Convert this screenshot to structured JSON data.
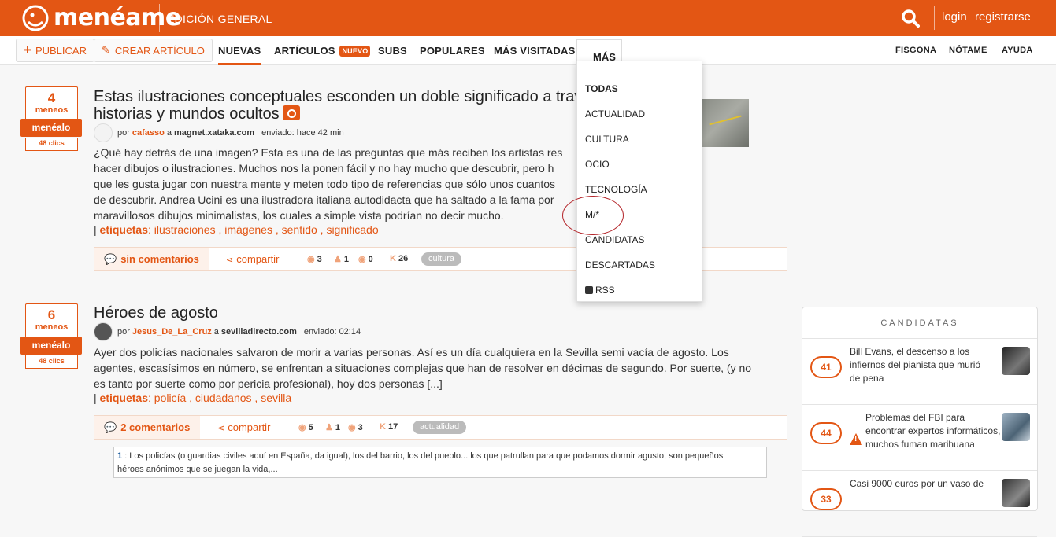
{
  "header": {
    "logo_text": "menéame",
    "edition": "EDICIÓN GENERAL",
    "login": "login",
    "register": "registrarse",
    "accent": "#e35614"
  },
  "nav": {
    "publish": "PUBLICAR",
    "create_article": "CREAR ARTÍCULO",
    "links": [
      "NUEVAS",
      "ARTÍCULOS",
      "SUBS",
      "POPULARES",
      "MÁS VISITADAS",
      "MÁS"
    ],
    "new_badge": "NUEVO",
    "right_links": [
      "FISGONA",
      "NÓTAME",
      "AYUDA"
    ]
  },
  "dropdown": {
    "items": [
      "TODAS",
      "ACTUALIDAD",
      "CULTURA",
      "OCIO",
      "TECNOLOGÍA",
      "M/*",
      "CANDIDATAS",
      "DESCARTADAS",
      "RSS"
    ]
  },
  "stories": [
    {
      "votes": "4",
      "votes_label": "meneos",
      "menealo": "menéalo",
      "clicks": "48 clics",
      "title_line1": "Estas ilustraciones conceptuales esconden un doble significado a través",
      "title_line2": "historias y mundos ocultos",
      "by": "por",
      "user": "cafasso",
      "at": "a",
      "domain": "magnet.xataka.com",
      "sent": "enviado: hace 42 min",
      "body": [
        "¿Qué hay detrás de una imagen? Esta es una de las preguntas que más reciben los artistas res",
        "hacer dibujos o ilustraciones. Muchos nos la ponen fácil y no hay mucho que descubrir, pero h",
        "que les gusta jugar con nuestra mente y meten todo tipo de referencias que sólo unos cuantos",
        "de descubrir. Andrea Ucini es una ilustradora italiana autodidacta que ha saltado a la fama por",
        "maravillosos dibujos minimalistas, los cuales a simple vista podrían no decir mucho."
      ],
      "tags_prefix": "|",
      "tags_label": "etiquetas",
      "tags": ": ilustraciones , imágenes , sentido , significado",
      "comments": "sin comentarios",
      "share": "compartir",
      "stat1": "3",
      "stat2": "1",
      "stat3": "0",
      "karma_label": "K",
      "karma": "26",
      "category": "cultura"
    },
    {
      "votes": "6",
      "votes_label": "meneos",
      "menealo": "menéalo",
      "clicks": "48 clics",
      "title_line1": "Héroes de agosto",
      "by": "por",
      "user": "Jesus_De_La_Cruz",
      "at": "a",
      "domain": "sevilladirecto.com",
      "sent": "enviado: 02:14",
      "body": [
        "Ayer dos policías nacionales salvaron de morir a varias personas. Así es un día cualquiera en la Sevilla semi vacía de agosto. Los",
        "agentes, escasísimos en número, se enfrentan a situaciones complejas que han de resolver en décimas de segundo. Por suerte, (y no",
        "es tanto por suerte como por pericia profesional), hoy dos personas [...]"
      ],
      "tags_prefix": "|",
      "tags_label": "etiquetas",
      "tags": ": policía , ciudadanos , sevilla",
      "comments": "2 comentarios",
      "share": "compartir",
      "stat1": "5",
      "stat2": "1",
      "stat3": "3",
      "karma_label": "K",
      "karma": "17",
      "category": "actualidad",
      "quote_num": "1",
      "quote_line1": " :  Los policías (o guardias civiles aquí en España, da igual), los del barrio, los del pueblo... los que patrullan para que podamos dormir agusto, son pequeños",
      "quote_line2": "héroes anónimos que se juegan la vida,..."
    }
  ],
  "sidebar": {
    "title": "CANDIDATAS",
    "items": [
      {
        "num": "41",
        "text": "Bill Evans, el descenso a los infiernos del pianista que murió de pena"
      },
      {
        "num": "44",
        "text": "Problemas del FBI para encontrar expertos informáticos, muchos fuman marihuana"
      },
      {
        "num": "33",
        "text": "Casi 9000 euros por un vaso de"
      }
    ]
  }
}
